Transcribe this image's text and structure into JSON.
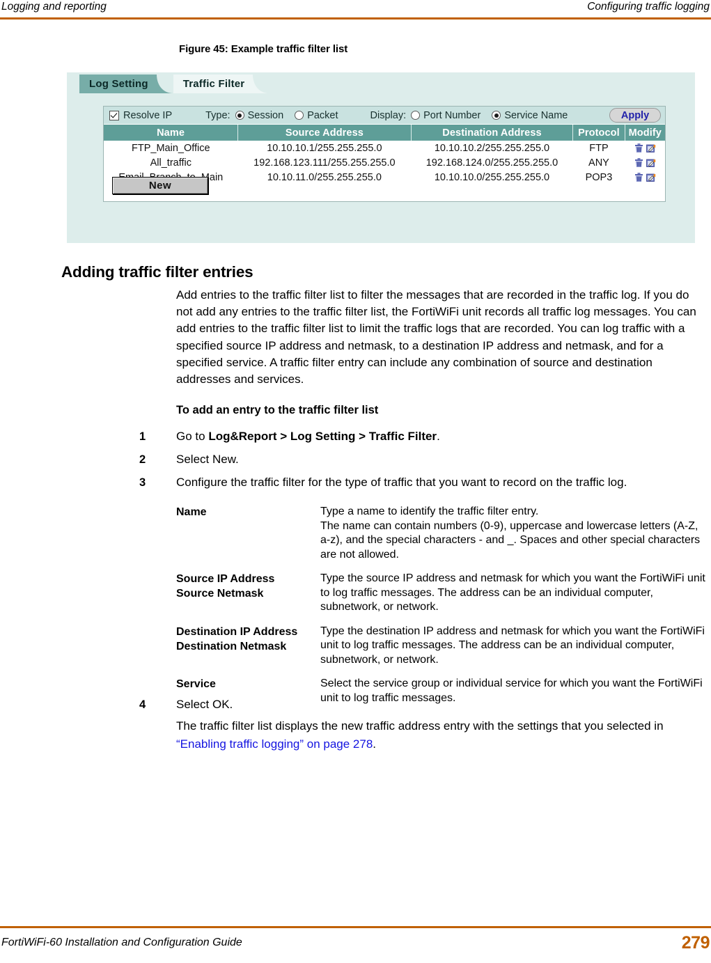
{
  "header": {
    "left": "Logging and reporting",
    "right": "Configuring traffic logging",
    "rule_color": "#C06000"
  },
  "figure": {
    "caption": "Figure 45: Example traffic filter list"
  },
  "screenshot": {
    "tabs": [
      {
        "label": "Log Setting",
        "active": false
      },
      {
        "label": "Traffic Filter",
        "active": true
      }
    ],
    "options": {
      "resolve_ip_label": "Resolve IP",
      "resolve_ip_checked": true,
      "type_label": "Type:",
      "type_options": [
        {
          "label": "Session",
          "selected": true
        },
        {
          "label": "Packet",
          "selected": false
        }
      ],
      "display_label": "Display:",
      "display_options": [
        {
          "label": "Port Number",
          "selected": false
        },
        {
          "label": "Service Name",
          "selected": true
        }
      ],
      "apply_label": "Apply"
    },
    "table": {
      "columns": [
        "Name",
        "Source Address",
        "Destination Address",
        "Protocol",
        "Modify"
      ],
      "rows": [
        {
          "name": "FTP_Main_Office",
          "source": "10.10.10.1/255.255.255.0",
          "destination": "10.10.10.2/255.255.255.0",
          "protocol": "FTP"
        },
        {
          "name": "All_traffic",
          "source": "192.168.123.111/255.255.255.0",
          "destination": "192.168.124.0/255.255.255.0",
          "protocol": "ANY"
        },
        {
          "name": "Email_Branch_to_Main",
          "source": "10.10.11.0/255.255.255.0",
          "destination": "10.10.10.0/255.255.255.0",
          "protocol": "POP3"
        }
      ],
      "row_icons": [
        "delete-icon",
        "edit-icon"
      ]
    },
    "new_button_label": "New",
    "colors": {
      "panel_background": "#DDEDEB",
      "tab_inactive": "#77ADA8",
      "tab_active": "#EEF6F5",
      "table_header": "#5E9E98",
      "options_bar": "#C9E2E0",
      "apply_text": "#2222AA"
    }
  },
  "content": {
    "section_heading": "Adding traffic filter entries",
    "intro_paragraph": "Add entries to the traffic filter list to filter the messages that are recorded in the traffic log. If you do not add any entries to the traffic filter list, the FortiWiFi unit records all traffic log messages. You can add entries to the traffic filter list to limit the traffic logs that are recorded. You can log traffic with a specified source IP address and netmask, to a destination IP address and netmask, and for a specified service. A traffic filter entry can include any combination of source and destination addresses and services.",
    "procedure_title": "To add an entry to the traffic filter list",
    "steps": [
      {
        "num": "1",
        "prefix": "Go to ",
        "bold": "Log&Report > Log Setting > Traffic Filter",
        "suffix": "."
      },
      {
        "num": "2",
        "prefix": "Select New.",
        "bold": "",
        "suffix": ""
      },
      {
        "num": "3",
        "prefix": "Configure the traffic filter for the type of traffic that you want to record on the traffic log.",
        "bold": "",
        "suffix": ""
      }
    ],
    "definitions": [
      {
        "term_line1": "Name",
        "term_line2": "",
        "desc_line1": "Type a name to identify the traffic filter entry.",
        "desc_line2": "The name can contain numbers (0-9), uppercase and lowercase letters (A-Z, a-z), and the special characters - and _. Spaces and other special characters are not allowed."
      },
      {
        "term_line1": "Source IP Address",
        "term_line2": "Source Netmask",
        "desc_line1": "Type the source IP address and netmask for which you want the FortiWiFi unit to log traffic messages. The address can be an individual computer, subnetwork, or network.",
        "desc_line2": ""
      },
      {
        "term_line1": "Destination IP Address",
        "term_line2": "Destination Netmask",
        "desc_line1": "Type the destination IP address and netmask for which you want the FortiWiFi unit to log traffic messages. The address can be an individual computer, subnetwork, or network.",
        "desc_line2": ""
      },
      {
        "term_line1": "Service",
        "term_line2": "",
        "desc_line1": "Select the service group or individual service for which you want the FortiWiFi unit to log traffic messages.",
        "desc_line2": ""
      }
    ],
    "step4": {
      "num": "4",
      "text": "Select OK."
    },
    "closing_prefix": "The traffic filter list displays the new traffic address entry with the settings that you selected in ",
    "closing_xref": "“Enabling traffic logging” on page 278",
    "closing_suffix": "."
  },
  "footer": {
    "title": "FortiWiFi-60 Installation and Configuration Guide",
    "page_number": "279",
    "rule_color": "#C06000",
    "page_number_color": "#C06000"
  }
}
